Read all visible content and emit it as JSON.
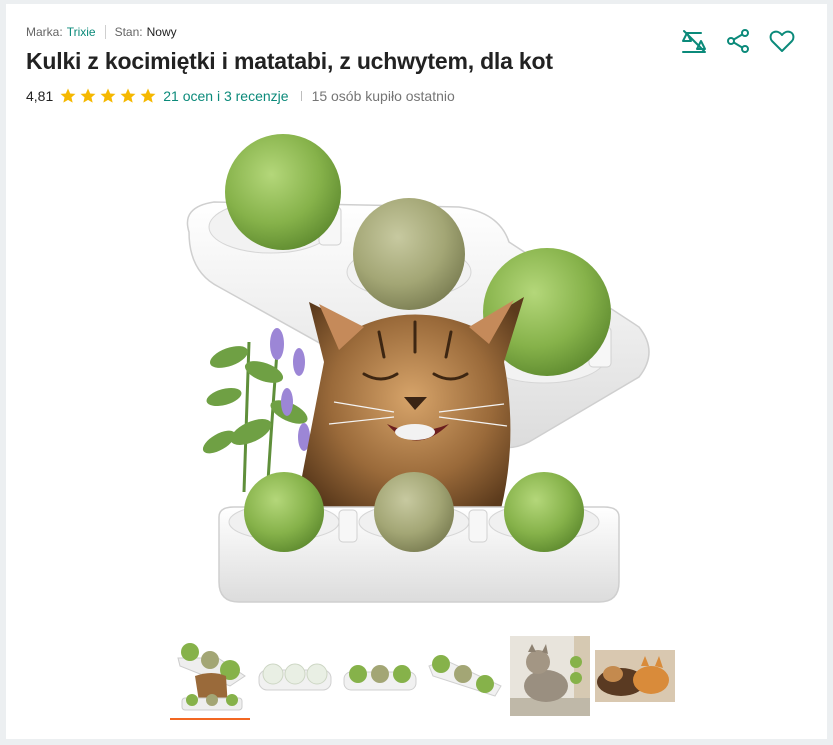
{
  "meta": {
    "brand_label": "Marka:",
    "brand_value": "Trixie",
    "condition_label": "Stan:",
    "condition_value": "Nowy"
  },
  "product": {
    "title": "Kulki z kocimiętki i matatabi, z uchwytem, dla kot"
  },
  "rating": {
    "value": "4,81",
    "stars": 5,
    "reviews_link": "21 ocen i 3 recenzje",
    "bought_recently": "15 osób kupiło ostatnio"
  },
  "actions": {
    "compare_icon": "scales-icon",
    "share_icon": "share-icon",
    "favorite_icon": "heart-icon"
  },
  "colors": {
    "accent": "#0b8a7a",
    "star": "#f5b800",
    "active_thumb": "#f26722",
    "catnip_green": "#8dbb4f",
    "matatabi_tan": "#a9ac7c"
  },
  "gallery": {
    "active_index": 0,
    "thumbnail_count": 6
  }
}
